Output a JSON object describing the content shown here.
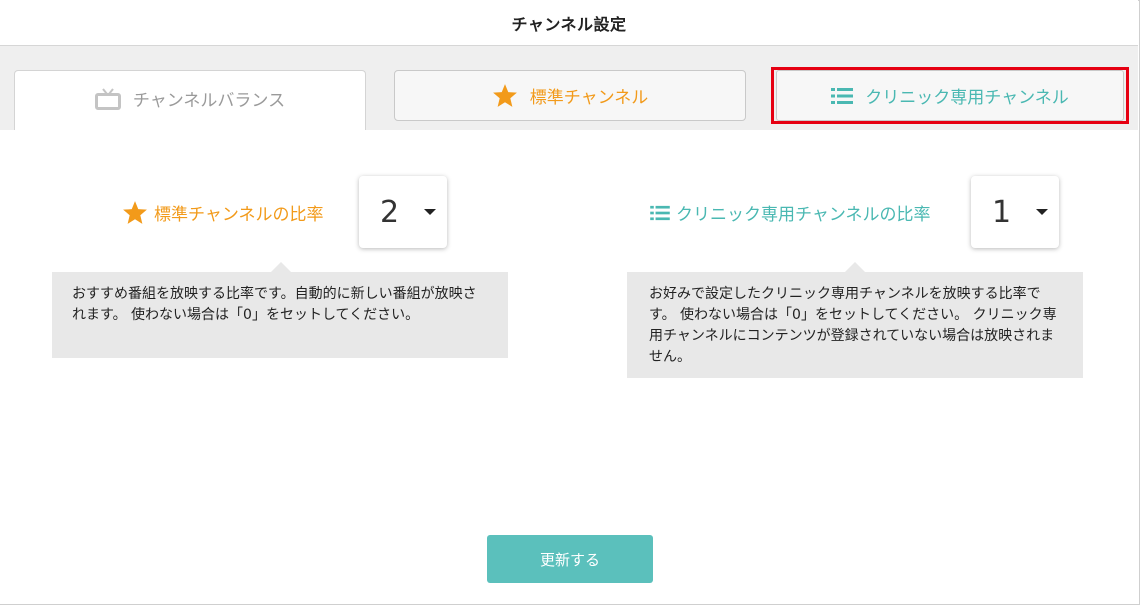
{
  "header": {
    "title": "チャンネル設定"
  },
  "tabs": {
    "balance": {
      "label": "チャンネルバランス",
      "icon": "tv-icon"
    },
    "standard": {
      "label": "標準チャンネル",
      "icon": "star-icon"
    },
    "clinic": {
      "label": "クリニック専用チャンネル",
      "icon": "list-icon"
    }
  },
  "standard_ratio": {
    "label": "標準チャンネルの比率",
    "value": "2",
    "note": "おすすめ番組を放映する比率です。自動的に新しい番組が放映されます。 使わない場合は「0」をセットしてください。"
  },
  "clinic_ratio": {
    "label": "クリニック専用チャンネルの比率",
    "value": "1",
    "note": "お好みで設定したクリニック専用チャンネルを放映する比率です。 使わない場合は「0」をセットしてください。 クリニック専用チャンネルにコンテンツが登録されていない場合は放映されません。"
  },
  "actions": {
    "update_label": "更新する"
  },
  "colors": {
    "accent_orange": "#f29a1a",
    "accent_teal": "#4ab8b2",
    "button_teal": "#5bc0bc",
    "highlight_red": "#e60012"
  }
}
